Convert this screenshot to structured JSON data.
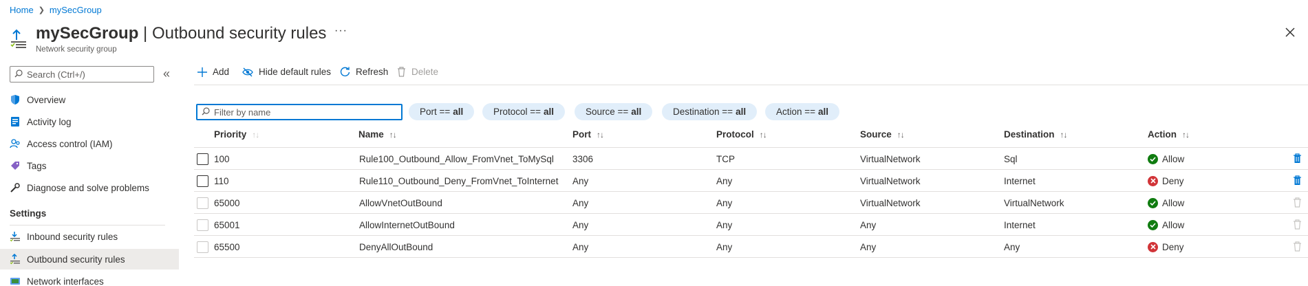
{
  "breadcrumb": {
    "home": "Home",
    "current": "mySecGroup"
  },
  "header": {
    "title_resource": "mySecGroup",
    "title_separator": " | ",
    "title_page": "Outbound security rules",
    "subtitle": "Network security group",
    "more": "···"
  },
  "sidebar": {
    "search_placeholder": "Search (Ctrl+/)",
    "collapse": "«",
    "items": [
      {
        "label": "Overview",
        "icon": "shield-icon"
      },
      {
        "label": "Activity log",
        "icon": "activity-log-icon"
      },
      {
        "label": "Access control (IAM)",
        "icon": "people-icon"
      },
      {
        "label": "Tags",
        "icon": "tag-icon"
      },
      {
        "label": "Diagnose and solve problems",
        "icon": "wrench-icon"
      }
    ],
    "settings_header": "Settings",
    "settings_items": [
      {
        "label": "Inbound security rules",
        "icon": "inbound-rules-icon",
        "selected": false
      },
      {
        "label": "Outbound security rules",
        "icon": "outbound-rules-icon",
        "selected": true
      },
      {
        "label": "Network interfaces",
        "icon": "network-interface-icon",
        "selected": false
      }
    ]
  },
  "toolbar": {
    "add": "Add",
    "hide_default": "Hide default rules",
    "refresh": "Refresh",
    "delete": "Delete"
  },
  "filters": {
    "name_placeholder": "Filter by name",
    "pills": [
      {
        "key": "Port ==",
        "value": "all"
      },
      {
        "key": "Protocol ==",
        "value": "all"
      },
      {
        "key": "Source ==",
        "value": "all"
      },
      {
        "key": "Destination ==",
        "value": "all"
      },
      {
        "key": "Action ==",
        "value": "all"
      }
    ]
  },
  "table": {
    "sort_glyph": "↑↓",
    "columns": [
      "Priority",
      "Name",
      "Port",
      "Protocol",
      "Source",
      "Destination",
      "Action"
    ],
    "rows": [
      {
        "priority": "100",
        "name": "Rule100_Outbound_Allow_FromVnet_ToMySql",
        "port": "3306",
        "protocol": "TCP",
        "source": "VirtualNetwork",
        "destination": "Sql",
        "action": "Allow",
        "custom": true
      },
      {
        "priority": "110",
        "name": "Rule110_Outbound_Deny_FromVnet_ToInternet",
        "port": "Any",
        "protocol": "Any",
        "source": "VirtualNetwork",
        "destination": "Internet",
        "action": "Deny",
        "custom": true
      },
      {
        "priority": "65000",
        "name": "AllowVnetOutBound",
        "port": "Any",
        "protocol": "Any",
        "source": "VirtualNetwork",
        "destination": "VirtualNetwork",
        "action": "Allow",
        "custom": false
      },
      {
        "priority": "65001",
        "name": "AllowInternetOutBound",
        "port": "Any",
        "protocol": "Any",
        "source": "Any",
        "destination": "Internet",
        "action": "Allow",
        "custom": false
      },
      {
        "priority": "65500",
        "name": "DenyAllOutBound",
        "port": "Any",
        "protocol": "Any",
        "source": "Any",
        "destination": "Any",
        "action": "Deny",
        "custom": false
      }
    ]
  },
  "colors": {
    "accent": "#0078d4",
    "allow": "#107c10",
    "deny": "#d13438",
    "pill_bg": "#e1eefa",
    "selected_bg": "#edebe9"
  }
}
